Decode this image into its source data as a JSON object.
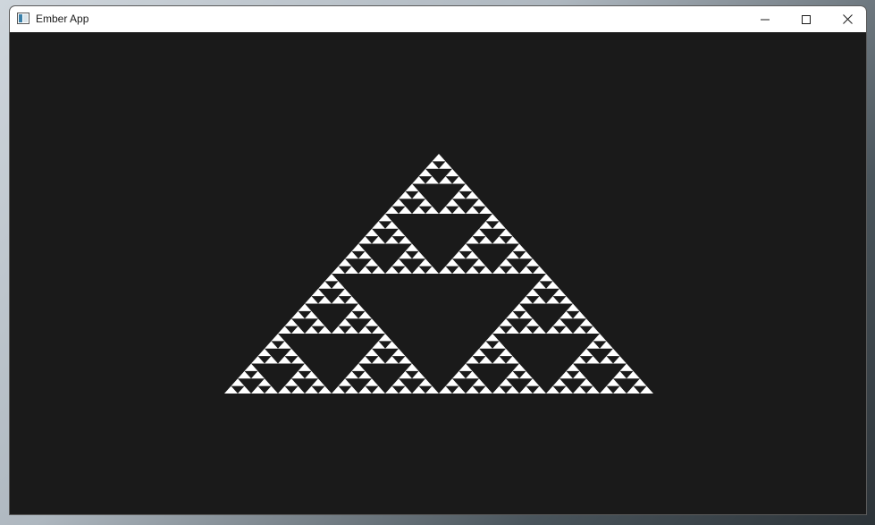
{
  "window": {
    "title": "Ember App",
    "app_icon": "app-window-icon",
    "controls": {
      "minimize_icon": "minimize-icon",
      "maximize_icon": "maximize-icon",
      "close_icon": "close-icon"
    }
  },
  "canvas": {
    "content": "sierpinski-triangle",
    "depth": 5,
    "background_color": "#1a1a1a",
    "fill_color": "#ffffff"
  }
}
